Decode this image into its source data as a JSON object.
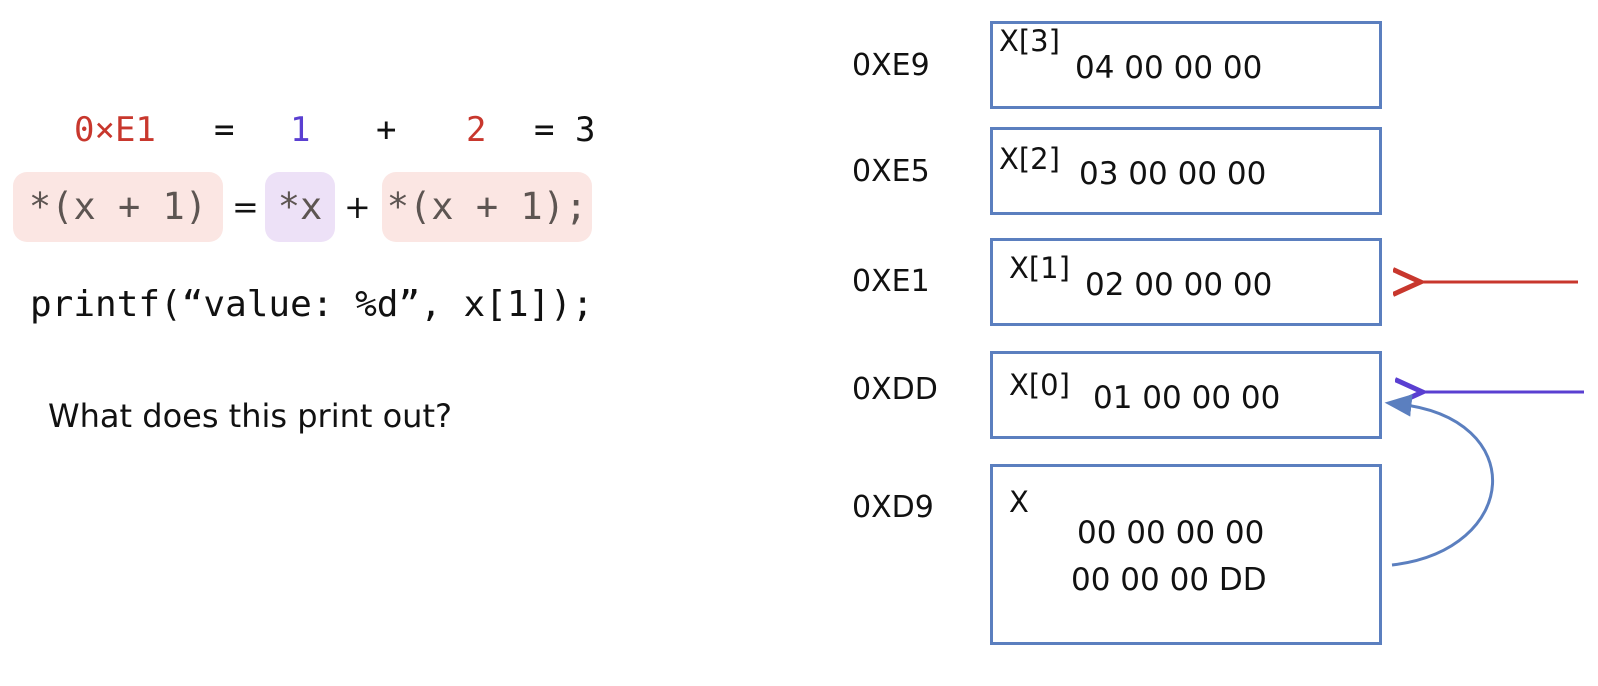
{
  "equation": {
    "address": "0×E1",
    "eq1": "=",
    "one": "1",
    "plus": "+",
    "two": "2",
    "result": "= 3",
    "address_color": "#c8372d",
    "one_color": "#5a3fd1",
    "two_color": "#c8372d"
  },
  "expression": {
    "lhs": "*(x + 1)",
    "eq": "=",
    "deref": "*x",
    "plus": "+",
    "rhs": "*(x + 1);"
  },
  "code_line": "printf(“value: %d”, x[1]);",
  "question": "What does this print out?",
  "memory": [
    {
      "address": "0XE9",
      "label": "X[3]",
      "bytes": "04 00 00 00"
    },
    {
      "address": "0XE5",
      "label": "X[2]",
      "bytes": "03 00 00 00"
    },
    {
      "address": "0XE1",
      "label": "X[1]",
      "bytes": "02 00 00 00"
    },
    {
      "address": "0XDD",
      "label": "X[0]",
      "bytes": "01 00 00 00"
    },
    {
      "address": "0XD9",
      "label": "X",
      "bytes_line1": "00 00 00 00",
      "bytes_line2": "00 00 00 DD"
    }
  ],
  "arrow_colors": {
    "red": "#c8372d",
    "purple": "#5a3fd1",
    "curve": "#5b7fbf"
  }
}
